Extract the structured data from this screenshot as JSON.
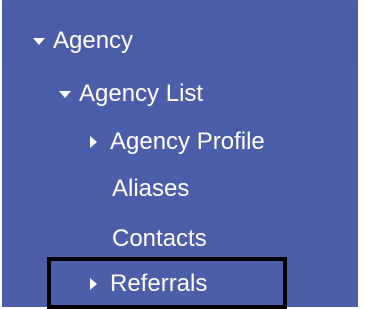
{
  "nav": {
    "agency": {
      "label": "Agency",
      "icon": "caret-down-icon"
    },
    "agency_list": {
      "label": "Agency List",
      "icon": "caret-down-icon"
    },
    "agency_profile": {
      "label": "Agency Profile",
      "icon": "caret-right-icon"
    },
    "aliases": {
      "label": "Aliases"
    },
    "contacts": {
      "label": "Contacts"
    },
    "referrals": {
      "label": "Referrals",
      "icon": "caret-right-icon",
      "highlighted": true
    }
  },
  "colors": {
    "sidebar_bg": "#4c5ea9",
    "text": "#ffffff",
    "highlight_border": "#000000"
  }
}
